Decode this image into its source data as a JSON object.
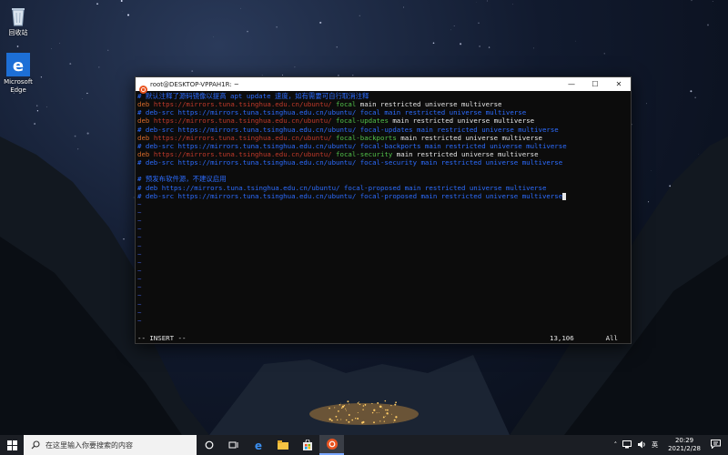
{
  "desktop": {
    "icons": [
      {
        "label": "回收站",
        "icon": "recycle-bin-icon"
      },
      {
        "label": "Microsoft Edge",
        "label_line1": "Microsoft",
        "label_line2": "Edge",
        "icon": "edge-icon"
      }
    ]
  },
  "window": {
    "title": "root@DESKTOP-VPPAH1R: ~",
    "controls": {
      "minimize": "—",
      "maximize": "☐",
      "close": "✕"
    }
  },
  "terminal": {
    "lines": [
      {
        "parts": [
          {
            "t": "# 默认注释了源码镜像以提高 apt update 速度，如有需要可自行取消注释",
            "c": "comment"
          }
        ]
      },
      {
        "parts": [
          {
            "t": "deb ",
            "c": "deb"
          },
          {
            "t": "https://mirrors.tuna.tsinghua.edu.cn/ubuntu/ ",
            "c": "url"
          },
          {
            "t": "focal",
            "c": "green"
          },
          {
            "t": " main restricted universe multiverse",
            "c": "white"
          }
        ]
      },
      {
        "parts": [
          {
            "t": "# deb-src https://mirrors.tuna.tsinghua.edu.cn/ubuntu/ focal main restricted universe multiverse",
            "c": "comment"
          }
        ]
      },
      {
        "parts": [
          {
            "t": "deb ",
            "c": "deb"
          },
          {
            "t": "https://mirrors.tuna.tsinghua.edu.cn/ubuntu/ ",
            "c": "url"
          },
          {
            "t": "focal-updates",
            "c": "green"
          },
          {
            "t": " main restricted universe multiverse",
            "c": "white"
          }
        ]
      },
      {
        "parts": [
          {
            "t": "# deb-src https://mirrors.tuna.tsinghua.edu.cn/ubuntu/ focal-updates main restricted universe multiverse",
            "c": "comment"
          }
        ]
      },
      {
        "parts": [
          {
            "t": "deb ",
            "c": "deb"
          },
          {
            "t": "https://mirrors.tuna.tsinghua.edu.cn/ubuntu/ ",
            "c": "url"
          },
          {
            "t": "focal-backports",
            "c": "green"
          },
          {
            "t": " main restricted universe multiverse",
            "c": "white"
          }
        ]
      },
      {
        "parts": [
          {
            "t": "# deb-src https://mirrors.tuna.tsinghua.edu.cn/ubuntu/ focal-backports main restricted universe multiverse",
            "c": "comment"
          }
        ]
      },
      {
        "parts": [
          {
            "t": "deb ",
            "c": "deb"
          },
          {
            "t": "https://mirrors.tuna.tsinghua.edu.cn/ubuntu/ ",
            "c": "url"
          },
          {
            "t": "focal-security",
            "c": "green"
          },
          {
            "t": " main restricted universe multiverse",
            "c": "white"
          }
        ]
      },
      {
        "parts": [
          {
            "t": "# deb-src https://mirrors.tuna.tsinghua.edu.cn/ubuntu/ focal-security main restricted universe multiverse",
            "c": "comment"
          }
        ]
      },
      {
        "parts": [
          {
            "t": "",
            "c": "white"
          }
        ]
      },
      {
        "parts": [
          {
            "t": "# 预发布软件源，不建议启用",
            "c": "comment"
          }
        ]
      },
      {
        "parts": [
          {
            "t": "# deb https://mirrors.tuna.tsinghua.edu.cn/ubuntu/ focal-proposed main restricted universe multiverse",
            "c": "comment"
          }
        ]
      },
      {
        "parts": [
          {
            "t": "# deb-src https://mirrors.tuna.tsinghua.edu.cn/ubuntu/ focal-proposed main restricted universe multiverse",
            "c": "comment"
          }
        ],
        "cursor": true
      }
    ],
    "tilde": "~",
    "tilde_lines": 15,
    "status": {
      "mode": "-- INSERT --",
      "position": "13,106",
      "scroll": "All"
    }
  },
  "taskbar": {
    "search_placeholder": "在这里输入你要搜索的内容",
    "items": [
      "task-view-icon",
      "edge-icon",
      "file-explorer-icon",
      "store-icon",
      "ubuntu-icon"
    ],
    "tray": {
      "language": "英",
      "time": "20:29",
      "date": "2021/2/28"
    }
  },
  "colors": {
    "comment": "#2c6cff",
    "deb": "#d86a2a",
    "url": "#c23a2a",
    "green": "#52c24a",
    "white": "#e6e6e6",
    "tilde": "#3a55c8"
  }
}
